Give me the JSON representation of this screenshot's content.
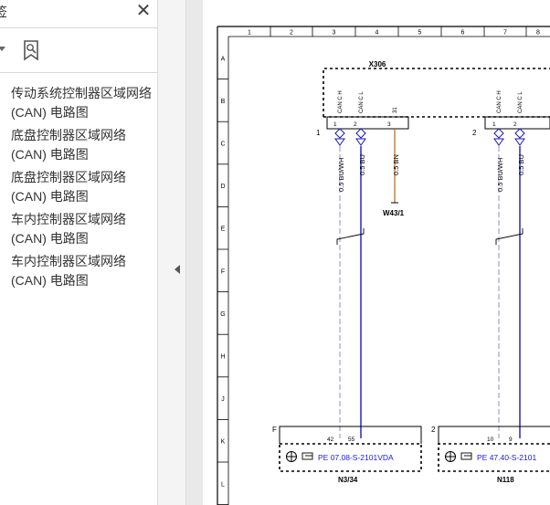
{
  "panel": {
    "title": "签",
    "close_glyph": "✕",
    "bookmarks": [
      {
        "line1": "传动系统控制器区域网络",
        "line2": "(CAN) 电路图"
      },
      {
        "line1": "底盘控制器区域网络",
        "line2": "(CAN) 电路图"
      },
      {
        "line1": "底盘控制器区域网络",
        "line2": "(CAN) 电路图"
      },
      {
        "line1": "车内控制器区域网络",
        "line2": "(CAN) 电路图"
      },
      {
        "line1": "车内控制器区域网络",
        "line2": "(CAN) 电路图"
      }
    ],
    "icons": [
      "close-icon",
      "dropdown-arrow-icon",
      "bookmark-icon",
      "collapse-arrow-icon"
    ]
  },
  "diagram": {
    "columns": [
      "1",
      "2",
      "3",
      "4",
      "5",
      "6",
      "7",
      "8"
    ],
    "rows": [
      "A",
      "B",
      "C",
      "D",
      "E",
      "F",
      "G",
      "H",
      "J",
      "K",
      "L"
    ],
    "connector_top": "X306",
    "group_left": "1",
    "group_right": "2",
    "pins_left": [
      {
        "label": "CAN C H",
        "num": "1"
      },
      {
        "label": "CAN C L",
        "num": "2"
      },
      {
        "label": "31",
        "num": "3"
      }
    ],
    "pins_right": [
      {
        "label": "CAN C H",
        "num": "1"
      },
      {
        "label": "CAN C L",
        "num": "2"
      }
    ],
    "wires_left": [
      "0.5 BU/WH",
      "0.5 BU",
      "0.5 BN"
    ],
    "wires_right": [
      "0.5 BU/WH",
      "0.5 BU"
    ],
    "ground_ref": "W43/1",
    "bottom_left": {
      "frame": "F",
      "pins": [
        "42",
        "55"
      ],
      "ref": "PE 07.08-S-2101VDA",
      "name": "N3/34"
    },
    "bottom_right": {
      "frame": "2",
      "pins": [
        "10",
        "9"
      ],
      "ref": "PE 47.40-S-2101",
      "name": "N118"
    },
    "colors": {
      "can_high": "#b9a8dc",
      "can_low": "#1a1ab8",
      "ground": "#b5651d",
      "link": "#1a1ae0"
    }
  }
}
